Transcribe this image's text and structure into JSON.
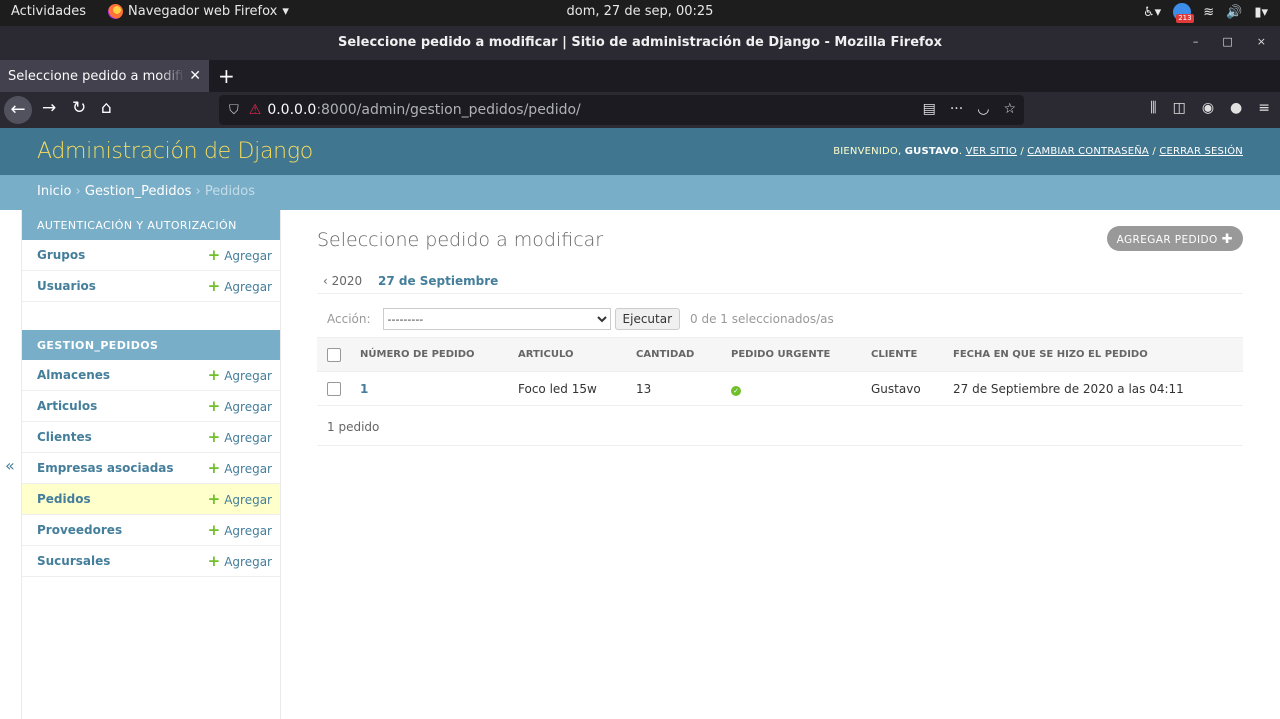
{
  "os": {
    "activities": "Actividades",
    "app_menu": "Navegador web Firefox",
    "clock": "dom, 27 de sep, 00:25",
    "badge_count": "213"
  },
  "window": {
    "title": "Seleccione pedido a modificar | Sitio de administración de Django - Mozilla Firefox"
  },
  "browser": {
    "tab_label": "Seleccione pedido a modificar",
    "url_host": "0.0.0.0",
    "url_path": ":8000/admin/gestion_pedidos/pedido/"
  },
  "django": {
    "branding": "Administración de Django",
    "welcome": "BIENVENIDO,",
    "username": "GUSTAVO",
    "links": [
      "VER SITIO",
      "CAMBIAR CONTRASEÑA",
      "CERRAR SESIÓN"
    ],
    "breadcrumbs": [
      "Inicio",
      "Gestion_Pedidos",
      "Pedidos"
    ],
    "add_label": "Agregar",
    "modules": [
      {
        "caption": "Autenticación y autorización",
        "models": [
          "Grupos",
          "Usuarios"
        ]
      },
      {
        "caption": "Gestion_pedidos",
        "models": [
          "Almacenes",
          "Articulos",
          "Clientes",
          "Empresas asociadas",
          "Pedidos",
          "Proveedores",
          "Sucursales"
        ]
      }
    ],
    "content": {
      "title": "Seleccione pedido a modificar",
      "add_button": "AGREGAR PEDIDO",
      "date_back": "‹ 2020",
      "date_current": "27 de Septiembre",
      "action_label": "Acción:",
      "action_selected": "---------",
      "go_button": "Ejecutar",
      "counter": "0 de 1 seleccionados/as",
      "columns": [
        "NÚMERO DE PEDIDO",
        "ARTICULO",
        "CANTIDAD",
        "PEDIDO URGENTE",
        "CLIENTE",
        "FECHA EN QUE SE HIZO EL PEDIDO"
      ],
      "rows": [
        [
          "1",
          "Foco led 15w",
          "13",
          true,
          "Gustavo",
          "27 de Septiembre de 2020 a las 04:11"
        ]
      ],
      "paginator": "1 pedido"
    }
  }
}
